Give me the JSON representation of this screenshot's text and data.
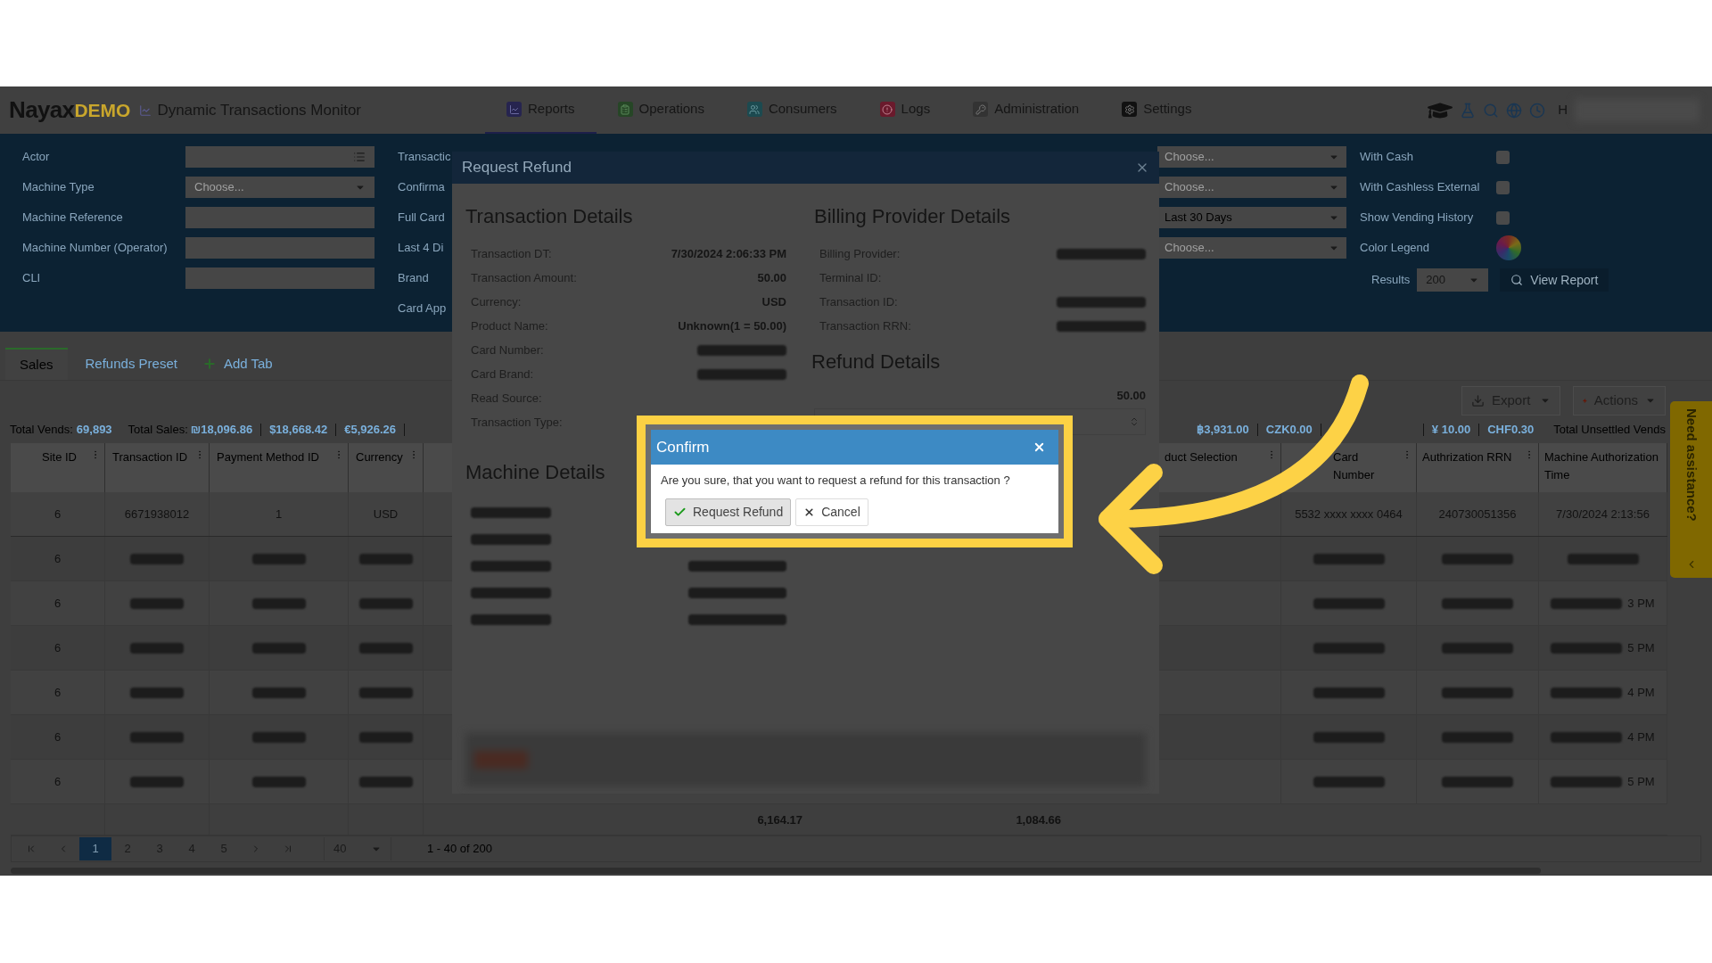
{
  "nav": {
    "logo_main": "Nayax",
    "logo_accent": "DEMO",
    "page_title": "Dynamic Transactions Monitor",
    "user_initial": "H",
    "tabs": [
      {
        "label": "Reports",
        "selected": true,
        "kind": "reports"
      },
      {
        "label": "Operations",
        "selected": false,
        "kind": "operations"
      },
      {
        "label": "Consumers",
        "selected": false,
        "kind": "consumers"
      },
      {
        "label": "Logs",
        "selected": false,
        "kind": "logs"
      },
      {
        "label": "Administration",
        "selected": false,
        "kind": "administration"
      },
      {
        "label": "Settings",
        "selected": false,
        "kind": "settings"
      }
    ]
  },
  "filters": {
    "fields": [
      {
        "label": "Actor",
        "kind": "list"
      },
      {
        "label": "Machine Type",
        "kind": "select",
        "placeholder": "Choose..."
      },
      {
        "label": "Machine Reference",
        "kind": "text"
      },
      {
        "label": "Machine Number (Operator)",
        "kind": "text"
      },
      {
        "label": "CLI",
        "kind": "text"
      }
    ],
    "column_2_labels": [
      "Transactic",
      "Confirma",
      "Full Card",
      "Last 4 Di",
      "Brand",
      "Card App"
    ],
    "selects": [
      {
        "placeholder": "Choose..."
      },
      {
        "placeholder": "Choose..."
      },
      {
        "value": "Last 30 Days"
      },
      {
        "placeholder": "Choose..."
      }
    ],
    "checkboxes": [
      {
        "label": "With Cash",
        "checked": false
      },
      {
        "label": "With Cashless External",
        "checked": false
      },
      {
        "label": "Show Vending History",
        "checked": false
      }
    ],
    "color_legend": "Color Legend",
    "results_label": "Results",
    "results_value": "200",
    "view_report": "View Report"
  },
  "tabs": [
    {
      "label": "Sales",
      "selected": true
    },
    {
      "label": "Refunds Preset",
      "selected": false
    }
  ],
  "add_tab": "Add Tab",
  "toolbar": {
    "export": "Export",
    "actions": "Actions"
  },
  "totals": {
    "vends_label": "Total Vends:",
    "vends": "69,893",
    "sales_label": "Total Sales:",
    "sales": [
      "₪18,096.86",
      "$18,668.42",
      "€5,926.26"
    ],
    "sales_right": [
      "฿3,931.00",
      "CZK0.00",
      "¥ 10.00",
      "CHF0.30"
    ],
    "unsettled_label": "Total Unsettled Vends"
  },
  "table": {
    "columns_left": [
      "Site ID",
      "Transaction ID",
      "Payment Method ID",
      "Currency"
    ],
    "columns_right": [
      "duct Selection",
      "Card Number",
      "Authrization RRN",
      "Machine Authorization Time"
    ],
    "rows": [
      {
        "site_id": "6",
        "transaction_id": "6671938012",
        "payment_method_id": "1",
        "currency": "USD",
        "card_number": "5532 xxxx xxxx 0464",
        "authrization_rrn": "240730051356",
        "machine_authorization_time": "7/30/2024 2:13:56",
        "blurred": false
      },
      {
        "site_id": "6",
        "blurred": true
      },
      {
        "site_id": "6",
        "machine_authorization_time": "3 PM",
        "blurred": true
      },
      {
        "site_id": "6",
        "machine_authorization_time": "5 PM",
        "blurred": true
      },
      {
        "site_id": "6",
        "machine_authorization_time": "4 PM",
        "blurred": true
      },
      {
        "site_id": "6",
        "machine_authorization_time": "4 PM",
        "blurred": true
      },
      {
        "site_id": "6",
        "machine_authorization_time": "5 PM",
        "blurred": true
      }
    ],
    "footer_totals": [
      "6,164.17",
      "1,084.66"
    ]
  },
  "pager": {
    "pages": [
      {
        "label": "1",
        "selected": true
      },
      {
        "label": "2",
        "selected": false
      },
      {
        "label": "3",
        "selected": false
      },
      {
        "label": "4",
        "selected": false
      },
      {
        "label": "5",
        "selected": false
      }
    ],
    "page_size": "40",
    "range": "1 - 40 of 200"
  },
  "assistance_tab": "Need assistance?",
  "refund_modal": {
    "title": "Request Refund",
    "transaction_details": {
      "heading": "Transaction Details",
      "rows": [
        {
          "label": "Transaction DT:",
          "value": "7/30/2024 2:06:33 PM",
          "blurred": false
        },
        {
          "label": "Transaction Amount:",
          "value": "50.00",
          "blurred": false
        },
        {
          "label": "Currency:",
          "value": "USD",
          "blurred": false
        },
        {
          "label": "Product Name:",
          "value": "Unknown(1 = 50.00)",
          "blurred": false
        },
        {
          "label": "Card Number:",
          "blurred": true
        },
        {
          "label": "Card Brand:",
          "blurred": true
        },
        {
          "label": "Read Source:",
          "blurred": false
        },
        {
          "label": "Transaction Type:"
        }
      ]
    },
    "billing": {
      "heading": "Billing Provider Details",
      "rows": [
        {
          "label": "Billing Provider:",
          "blurred": true
        },
        {
          "label": "Terminal ID:",
          "blurred": false
        },
        {
          "label": "Transaction ID:",
          "blurred": true
        },
        {
          "label": "Transaction RRN:",
          "blurred": true
        }
      ]
    },
    "refund_details": {
      "heading": "Refund Details",
      "amount": "50.00"
    },
    "machine_details": {
      "heading": "Machine Details"
    }
  },
  "confirm": {
    "title": "Confirm",
    "message": "Are you sure, that you want to request a refund for this transaction ?",
    "buttons": [
      {
        "label": "Request Refund",
        "kind": "confirm"
      },
      {
        "label": "Cancel",
        "kind": "cancel"
      }
    ]
  }
}
